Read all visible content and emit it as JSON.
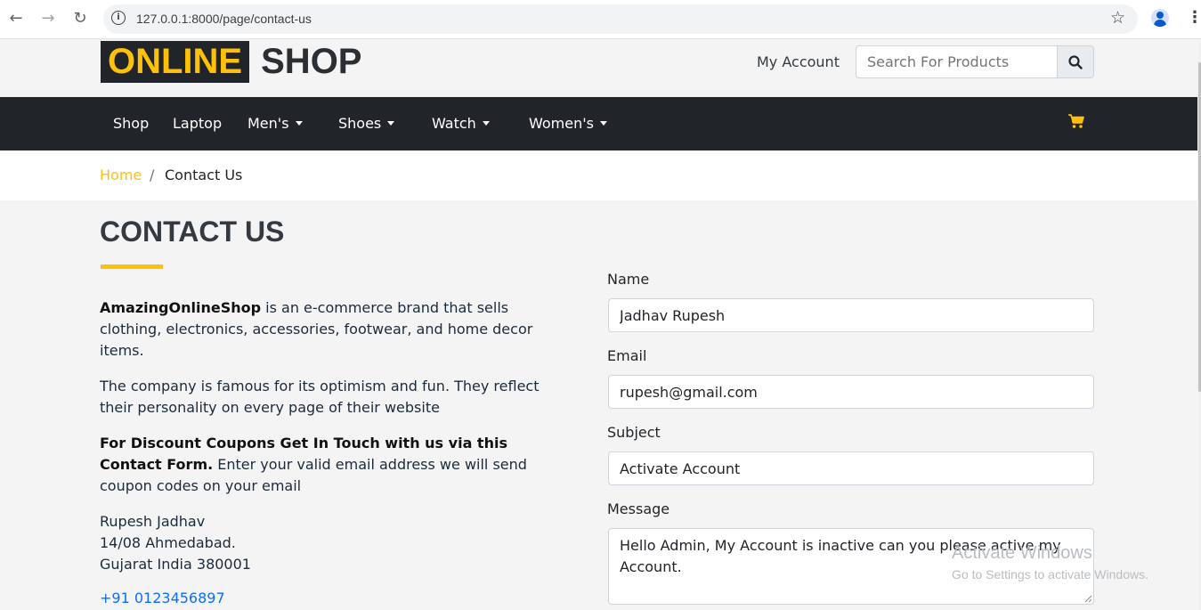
{
  "browser": {
    "url": "127.0.0.1:8000/page/contact-us"
  },
  "header": {
    "logo_highlight": "ONLINE",
    "logo_rest": "SHOP",
    "my_account": "My Account",
    "search_placeholder": "Search For Products"
  },
  "nav": {
    "items": [
      {
        "label": "Shop",
        "dropdown": false
      },
      {
        "label": "Laptop",
        "dropdown": false
      },
      {
        "label": "Men's",
        "dropdown": true
      },
      {
        "label": "Shoes",
        "dropdown": true
      },
      {
        "label": "Watch",
        "dropdown": true
      },
      {
        "label": "Women's",
        "dropdown": true
      }
    ]
  },
  "breadcrumb": {
    "home": "Home",
    "separator": "/",
    "current": "Contact Us"
  },
  "page": {
    "title": "CONTACT US",
    "intro_brand": "AmazingOnlineShop",
    "intro_rest": " is an e-commerce brand that sells clothing, electronics, accessories, footwear, and home decor items.",
    "para2": "The company is famous for its optimism and fun. They reflect their personality on every page of their website",
    "promo_bold": "For Discount Coupons Get In Touch with us via this Contact Form.",
    "promo_rest": " Enter your valid email address we will send coupon codes on your email",
    "address_name": "Rupesh Jadhav",
    "address_line1": "14/08 Ahmedabad.",
    "address_line2": "Gujarat India 380001",
    "phone": "+91 0123456897"
  },
  "form": {
    "name_label": "Name",
    "name_value": "Jadhav Rupesh",
    "email_label": "Email",
    "email_value": "rupesh@gmail.com",
    "subject_label": "Subject",
    "subject_value": "Activate Account",
    "message_label": "Message",
    "message_value": "Hello Admin, My Account is inactive can you please active my Account."
  },
  "watermark": {
    "line1": "Activate Windows",
    "line2": "Go to Settings to activate Windows."
  },
  "colors": {
    "accent": "#ffc107",
    "dark": "#212529",
    "link": "#0d6efd"
  }
}
